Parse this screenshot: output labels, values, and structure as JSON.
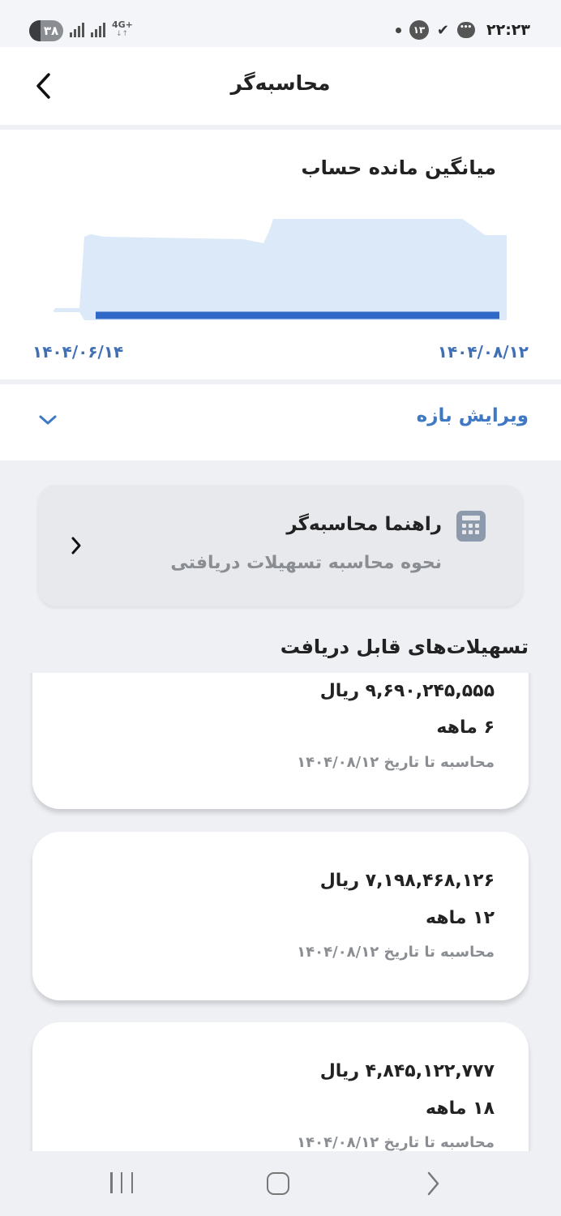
{
  "status_bar": {
    "battery": "۳۸",
    "network": "4G+",
    "time": "۲۲:۲۳",
    "notification_count": "۱۳"
  },
  "header": {
    "title": "محاسبه‌گر"
  },
  "balance_chart": {
    "title": "میانگین مانده حساب",
    "start_date": "۱۴۰۴/۰۶/۱۴",
    "end_date": "۱۴۰۴/۰۸/۱۲",
    "fill_color": "#dce9f8",
    "line_color": "#3068c8"
  },
  "edit_range": {
    "label": "ویرایش بازه"
  },
  "guide": {
    "title": "راهنما محاسبه‌گر",
    "subtitle": "نحوه محاسبه تسهیلات دریافتی",
    "icon": "calculator-icon"
  },
  "loans_section": {
    "title": "تسهیلات‌های قابل دریافت",
    "items": [
      {
        "amount": "۹,۶۹۰,۲۴۵,۵۵۵ ریال",
        "term": "۶ ماهه",
        "calc_date": "محاسبه تا تاریخ ۱۴۰۴/۰۸/۱۲"
      },
      {
        "amount": "۷,۱۹۸,۴۶۸,۱۲۶ ریال",
        "term": "۱۲ ماهه",
        "calc_date": "محاسبه تا تاریخ ۱۴۰۴/۰۸/۱۲"
      },
      {
        "amount": "۴,۸۴۵,۱۲۲,۷۷۷ ریال",
        "term": "۱۸ ماهه",
        "calc_date": "محاسبه تا تاریخ ۱۴۰۴/۰۸/۱۲"
      }
    ]
  },
  "nav": {
    "recent": "recent-apps-icon",
    "home": "home-icon",
    "back": "back-icon"
  }
}
